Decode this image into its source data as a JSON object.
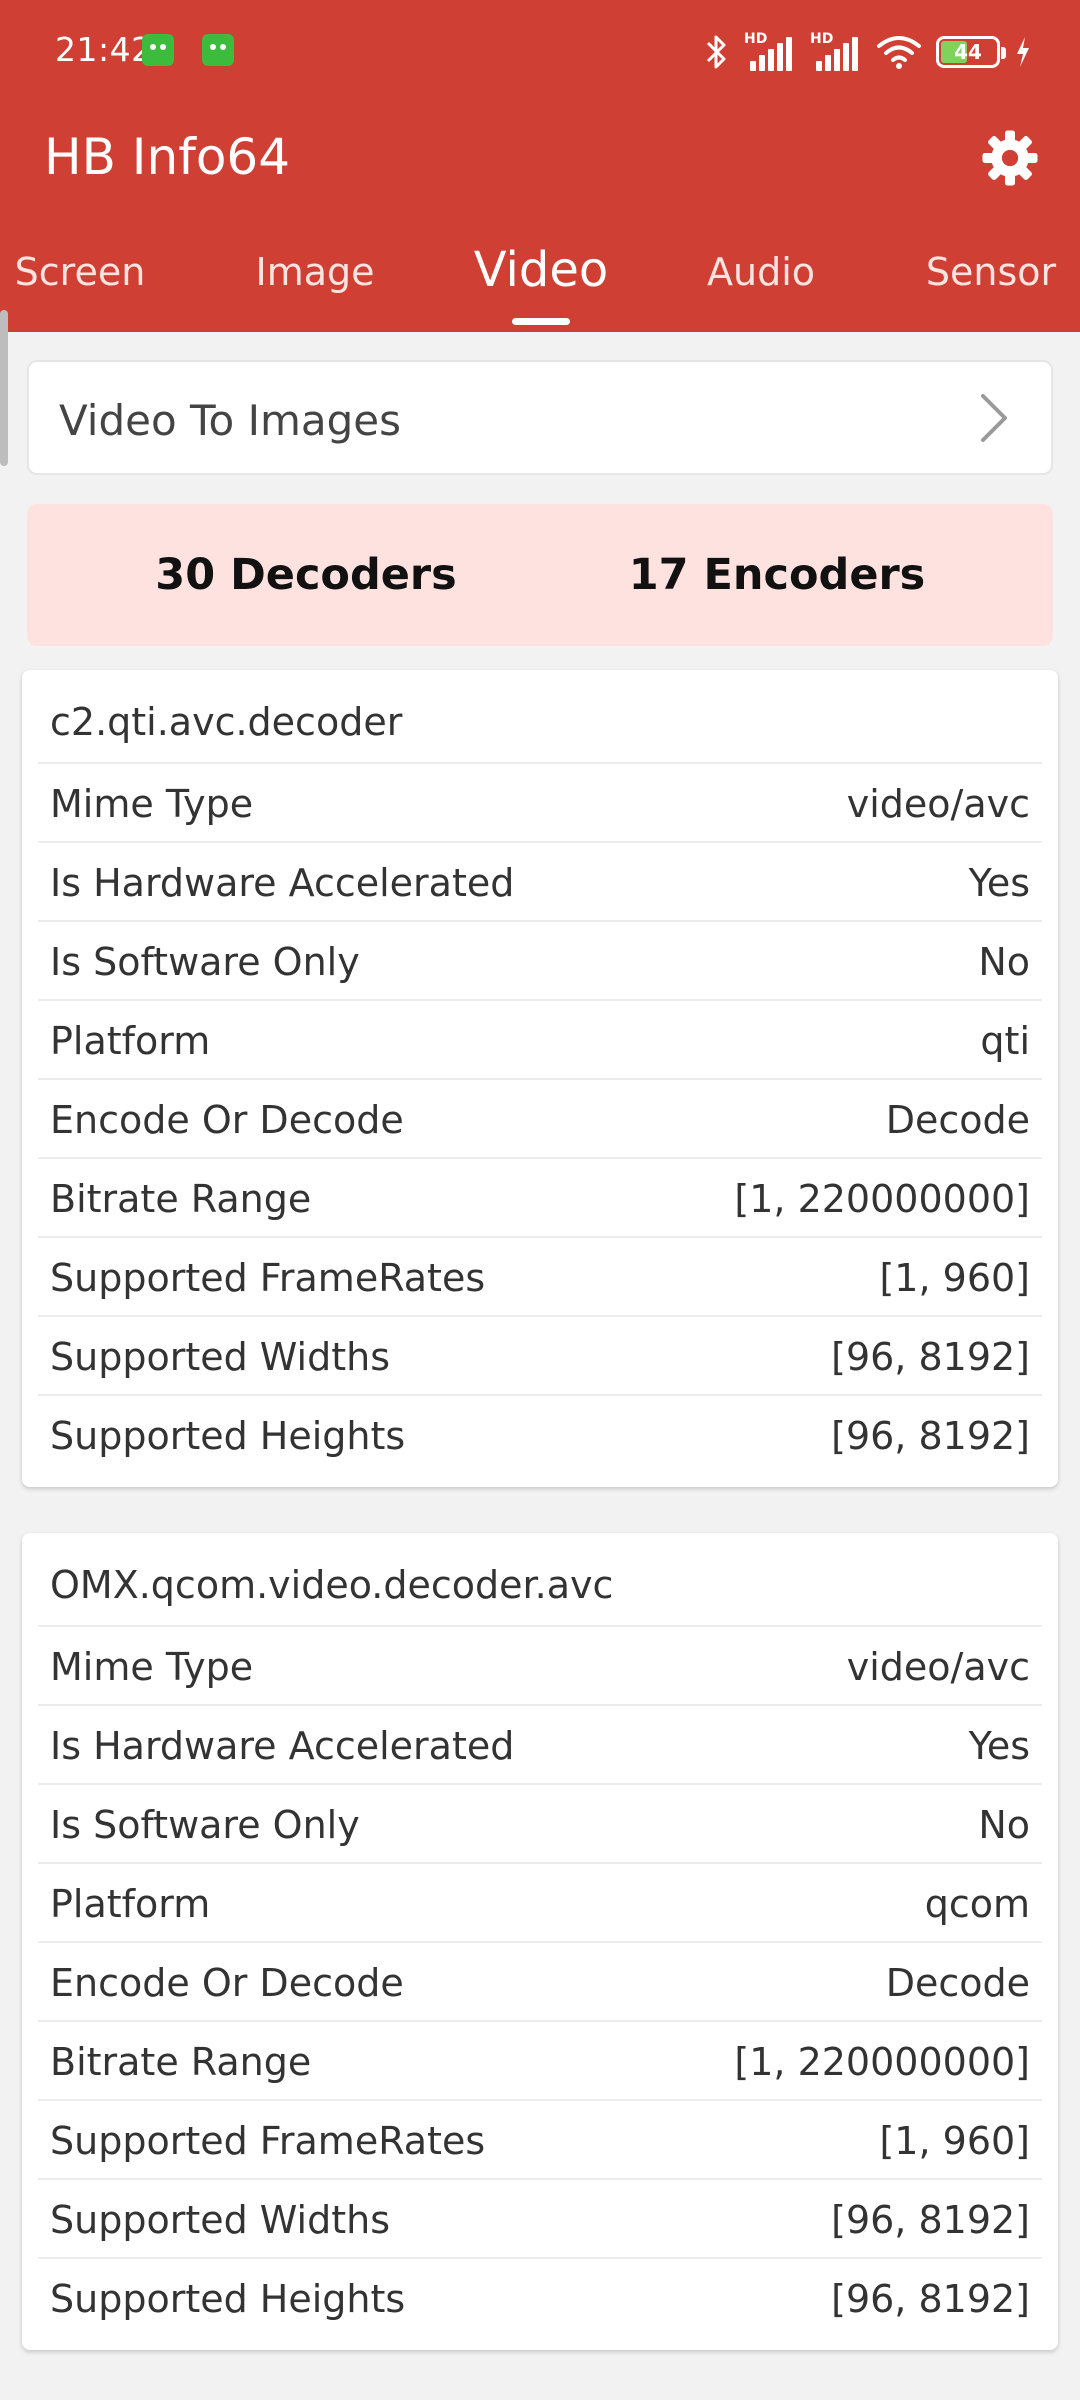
{
  "status_bar": {
    "time": "21:42",
    "battery": "44",
    "icons": [
      "android-notification-icon",
      "android-notification-icon",
      "bluetooth-icon",
      "hd-signal-icon",
      "hd-signal-icon",
      "wifi-icon",
      "battery-icon",
      "charging-icon"
    ],
    "signal_label_1": "HD",
    "signal_label_2": "HD"
  },
  "app_bar": {
    "title": "HB Info64",
    "settings_icon": "gear-icon",
    "background": "#cf3f33"
  },
  "tabs": [
    {
      "label": "Screen",
      "active": false
    },
    {
      "label": "Image",
      "active": false
    },
    {
      "label": "Video",
      "active": true
    },
    {
      "label": "Audio",
      "active": false
    },
    {
      "label": "Sensor",
      "active": false
    }
  ],
  "video_to_images": {
    "label": "Video To Images",
    "icon": "chevron-right-icon"
  },
  "summary": {
    "decoders": "30 Decoders",
    "encoders": "17 Encoders",
    "background": "#fde2df"
  },
  "codecs": [
    {
      "name": "c2.qti.avc.decoder",
      "rows": [
        {
          "key": "Mime Type",
          "value": "video/avc"
        },
        {
          "key": "Is Hardware Accelerated",
          "value": "Yes"
        },
        {
          "key": "Is Software Only",
          "value": "No"
        },
        {
          "key": "Platform",
          "value": "qti"
        },
        {
          "key": "Encode Or Decode",
          "value": "Decode"
        },
        {
          "key": "Bitrate Range",
          "value": "[1, 220000000]"
        },
        {
          "key": "Supported FrameRates",
          "value": "[1, 960]"
        },
        {
          "key": "Supported Widths",
          "value": "[96, 8192]"
        },
        {
          "key": "Supported Heights",
          "value": "[96, 8192]"
        }
      ]
    },
    {
      "name": "OMX.qcom.video.decoder.avc",
      "rows": [
        {
          "key": "Mime Type",
          "value": "video/avc"
        },
        {
          "key": "Is Hardware Accelerated",
          "value": "Yes"
        },
        {
          "key": "Is Software Only",
          "value": "No"
        },
        {
          "key": "Platform",
          "value": "qcom"
        },
        {
          "key": "Encode Or Decode",
          "value": "Decode"
        },
        {
          "key": "Bitrate Range",
          "value": "[1, 220000000]"
        },
        {
          "key": "Supported FrameRates",
          "value": "[1, 960]"
        },
        {
          "key": "Supported Widths",
          "value": "[96, 8192]"
        },
        {
          "key": "Supported Heights",
          "value": "[96, 8192]"
        }
      ]
    }
  ]
}
